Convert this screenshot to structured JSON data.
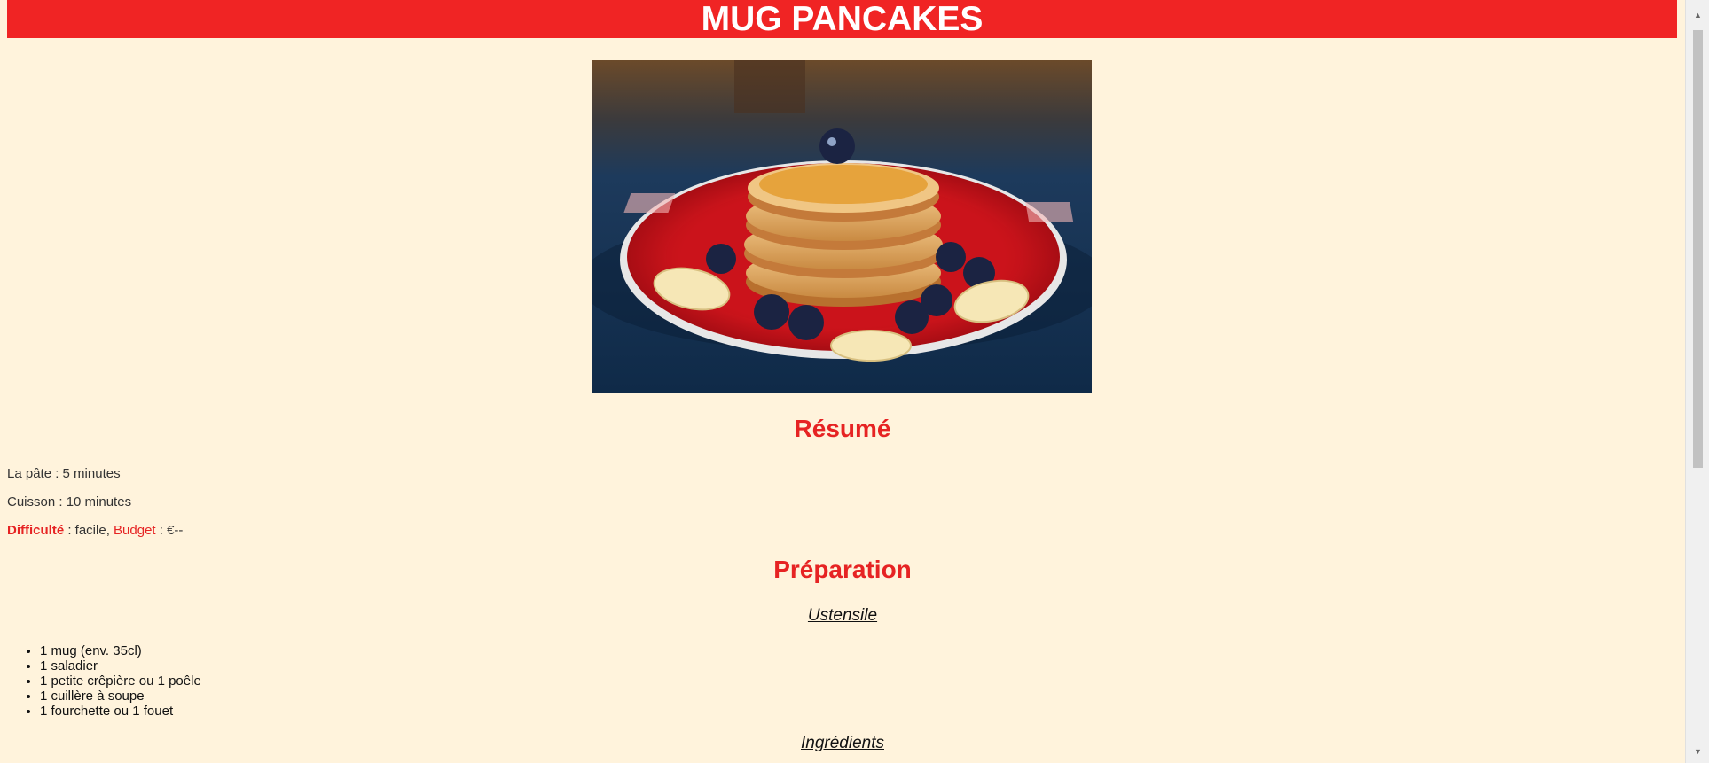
{
  "header": {
    "title": "MUG PANCAKES"
  },
  "hero_image": {
    "subject": "pancake-stack-photo"
  },
  "summary": {
    "heading": "Résumé",
    "prep_label": "La pâte : 5 minutes",
    "cook_label": "Cuisson : 10 minutes",
    "difficulty_label": "Difficulté",
    "difficulty_value": " : facile, ",
    "budget_label": "Budget",
    "budget_value": " : €--"
  },
  "preparation": {
    "heading": "Préparation",
    "tools_heading": "Ustensile",
    "tools": [
      "1 mug (env. 35cl)",
      "1 saladier",
      "1 petite crêpière ou 1 poêle",
      "1 cuillère à soupe",
      "1 fourchette ou 1 fouet"
    ],
    "ingredients_heading": "Ingrédients"
  },
  "colors": {
    "accent": "#e62323",
    "banner": "#f02424",
    "background": "#fff3dc"
  }
}
